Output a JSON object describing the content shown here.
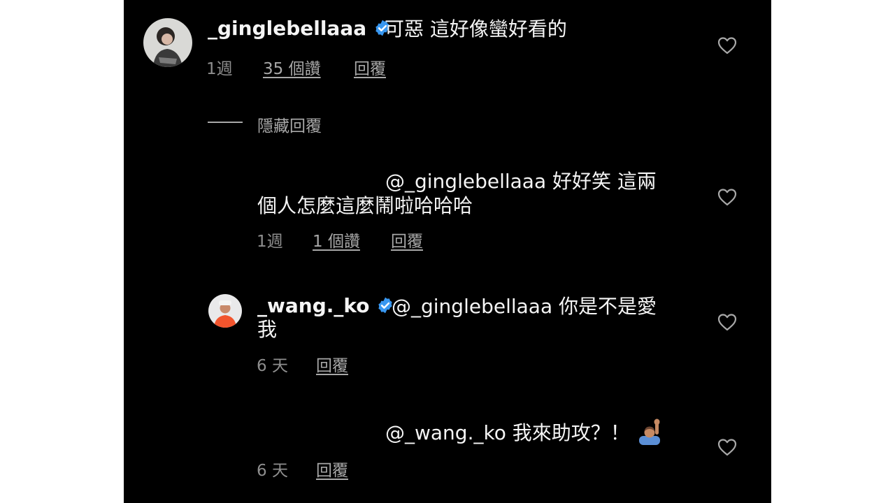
{
  "accent_verified": "#3897f0",
  "comments": [
    {
      "username": "_ginglebellaaa",
      "text": "可惡 這好像蠻好看的",
      "time": "1週",
      "likes": "35 個讚",
      "reply": "回覆"
    }
  ],
  "hide_replies": "隱藏回覆",
  "replies": [
    {
      "line1": "@_ginglebellaaa 好好笑 這兩",
      "line2": "個人怎麼這麼鬧啦哈哈哈",
      "time": "1週",
      "likes": "1 個讚",
      "reply": "回覆"
    },
    {
      "username": "_wang._ko",
      "line1": "@_ginglebellaaa 你是不是愛",
      "line2": "我",
      "time": "6 天",
      "reply": "回覆"
    },
    {
      "line1": "@_wang._ko 我來助攻？！",
      "time": "6 天",
      "reply": "回覆"
    }
  ]
}
